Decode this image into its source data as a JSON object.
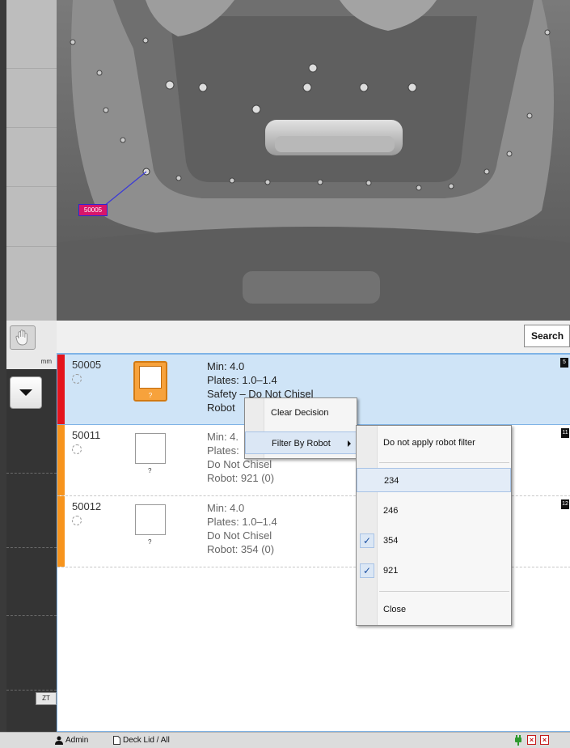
{
  "toolbar": {
    "unit_label": "mm",
    "zoom_label": "ZT"
  },
  "viewport": {
    "marker_label": "50005"
  },
  "search": {
    "button_label": "Search"
  },
  "rows": [
    {
      "id": "50005",
      "details": [
        "Min: 4.0",
        "Plates: 1.0–1.4",
        "Safety – Do Not Chisel",
        "Robot"
      ],
      "thumb_label": "?",
      "badge": "5",
      "status_color": "#e4141c"
    },
    {
      "id": "50011",
      "details": [
        "Min: 4.",
        "Plates:",
        "Do Not Chisel",
        "Robot: 921 (0)"
      ],
      "thumb_label": "?",
      "badge": "11",
      "status_color": "#f7941d"
    },
    {
      "id": "50012",
      "details": [
        "Min: 4.0",
        "Plates: 1.0–1.4",
        "Do Not Chisel",
        "Robot: 354 (0)"
      ],
      "thumb_label": "?",
      "badge": "12",
      "status_color": "#f7941d"
    }
  ],
  "context_menu": {
    "items": [
      "Clear Decision",
      "Filter By Robot"
    ]
  },
  "submenu": {
    "no_filter": "Do not apply robot filter",
    "robots": [
      {
        "label": "234",
        "checked": false
      },
      {
        "label": "246",
        "checked": false
      },
      {
        "label": "354",
        "checked": true
      },
      {
        "label": "921",
        "checked": true
      }
    ],
    "close": "Close",
    "check_glyph": "✓"
  },
  "status": {
    "user": "Admin",
    "path": "Deck Lid / All"
  }
}
